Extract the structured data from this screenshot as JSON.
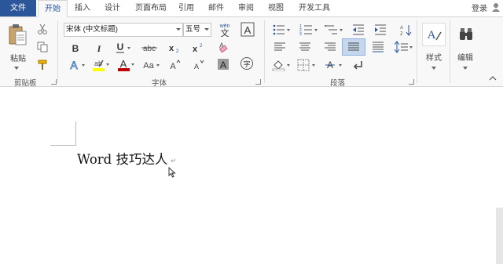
{
  "tabs": [
    {
      "label": "文件"
    },
    {
      "label": "开始"
    },
    {
      "label": "插入"
    },
    {
      "label": "设计"
    },
    {
      "label": "页面布局"
    },
    {
      "label": "引用"
    },
    {
      "label": "邮件"
    },
    {
      "label": "审阅"
    },
    {
      "label": "视图"
    },
    {
      "label": "开发工具"
    }
  ],
  "account": {
    "login_label": "登录"
  },
  "ribbon": {
    "clipboard": {
      "group_label": "剪贴板",
      "paste_label": "粘贴"
    },
    "font": {
      "group_label": "字体",
      "font_name": "宋体 (中文标题)",
      "font_size": "五号",
      "buttons": {
        "bold": "B",
        "italic": "I",
        "underline": "U",
        "strike": "abc",
        "subscript": "X₂",
        "superscript": "X²",
        "grow": "A^",
        "shrink": "A˅",
        "case": "Aa",
        "font_color": "A",
        "char_shading": "A",
        "enclose": "字",
        "phonetic": "wén 文"
      }
    },
    "paragraph": {
      "group_label": "段落"
    },
    "styles": {
      "label": "样式"
    },
    "editing": {
      "label": "编辑"
    }
  },
  "colors": {
    "file_tab": "#2b579a",
    "accent": "#2b579a",
    "highlight": "#ffff00",
    "font_color": "#c00000"
  },
  "document": {
    "text": "Word 技巧达人",
    "paragraph_mark": "↵"
  }
}
